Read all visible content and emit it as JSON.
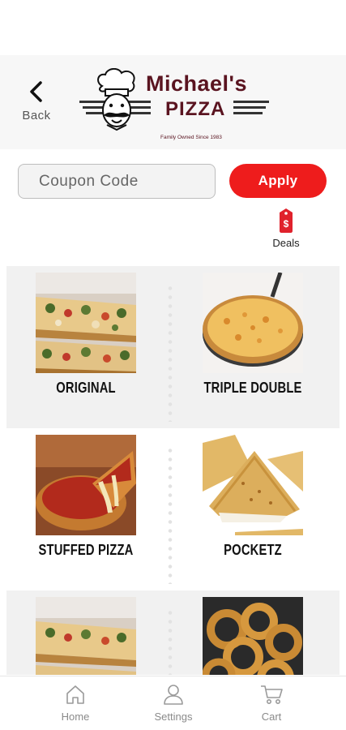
{
  "header": {
    "back_label": "Back",
    "logo": {
      "title": "Michael's",
      "subtitle": "PIZZA",
      "tagline": "Family Owned Since 1983",
      "color": "#5a1420"
    }
  },
  "coupon": {
    "placeholder": "Coupon Code",
    "value": "",
    "apply_label": "Apply",
    "accent": "#ee1c1c"
  },
  "deals": {
    "label": "Deals",
    "icon": "price-tag-icon",
    "icon_glyph": "$"
  },
  "menu": {
    "items": [
      {
        "label": "ORIGINAL",
        "image": "original-pizza-image"
      },
      {
        "label": "TRIPLE DOUBLE",
        "image": "triple-double-pizza-image"
      },
      {
        "label": "STUFFED PIZZA",
        "image": "stuffed-pizza-image"
      },
      {
        "label": "POCKETZ",
        "image": "pocketz-image"
      },
      {
        "label": "",
        "image": "pizza-slice-image"
      },
      {
        "label": "",
        "image": "onion-rings-image"
      }
    ]
  },
  "nav": {
    "items": [
      {
        "label": "Home",
        "icon": "home-icon"
      },
      {
        "label": "Settings",
        "icon": "user-icon"
      },
      {
        "label": "Cart",
        "icon": "cart-icon"
      }
    ]
  }
}
